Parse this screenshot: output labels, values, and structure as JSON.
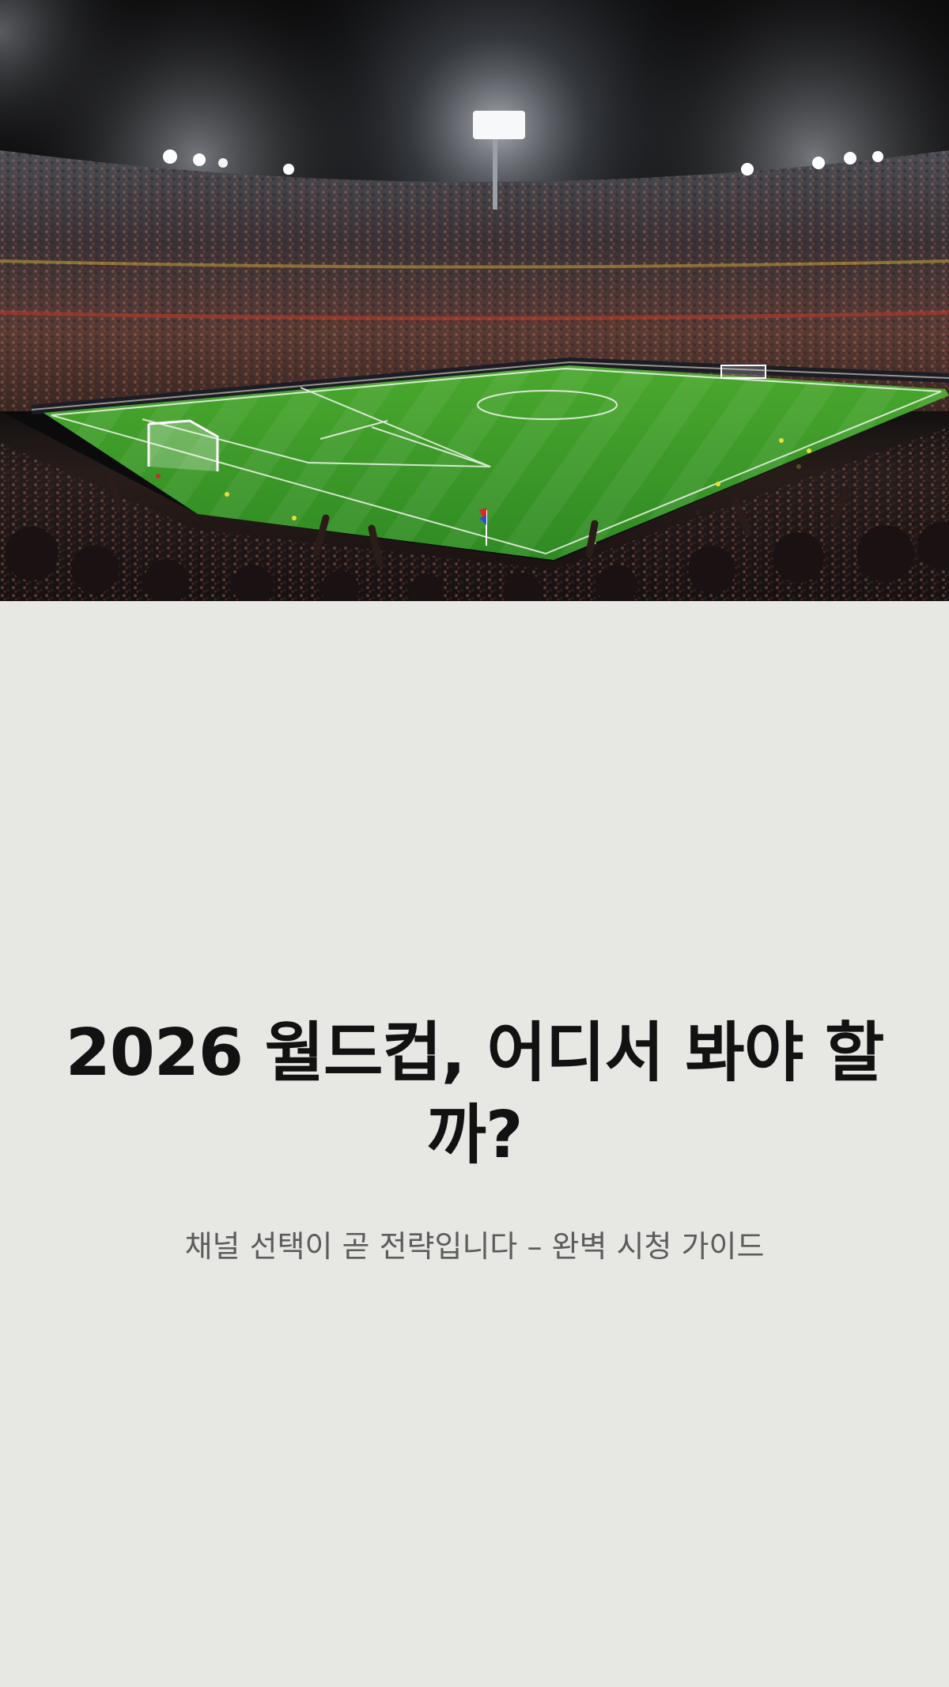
{
  "hero": {
    "image_icon": "stadium-photo-icon"
  },
  "article": {
    "title": "2026 월드컵, 어디서 봐야 할까?",
    "subtitle": "채널 선택이 곧 전략입니다 – 완벽 시청 가이드"
  },
  "colors": {
    "background": "#e7e7e3",
    "title": "#121212",
    "subtitle": "#5c5c5c",
    "pitch": "#3f9a2a"
  }
}
